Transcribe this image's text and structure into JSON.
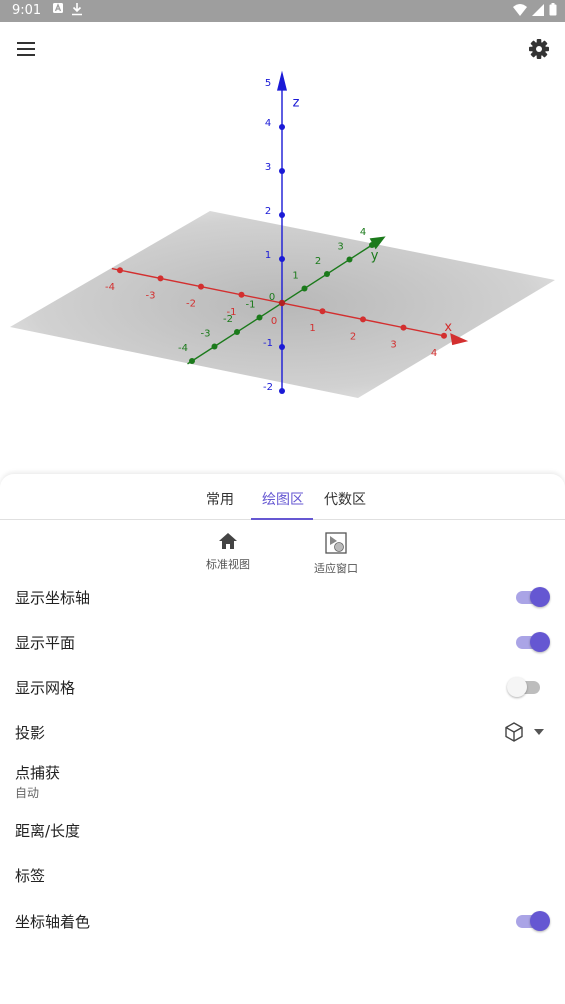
{
  "status_bar": {
    "time": "9:01"
  },
  "graph": {
    "x_axis_label": "x",
    "y_axis_label": "y",
    "z_axis_label": "z",
    "origin_label": "0",
    "x_ticks": [
      "-4",
      "-3",
      "-2",
      "-1",
      "1",
      "2",
      "3",
      "4"
    ],
    "y_ticks": [
      "-4",
      "-3",
      "-2",
      "-1",
      "1",
      "2",
      "3",
      "4"
    ],
    "z_ticks": [
      "-2",
      "-1",
      "1",
      "2",
      "3",
      "4",
      "5"
    ],
    "colors": {
      "x_axis": "#d32f2f",
      "y_axis": "#1b7a1b",
      "z_axis": "#1a1ad6",
      "plane": "#c8c8c8"
    }
  },
  "tabs": [
    {
      "label": "常用"
    },
    {
      "label": "绘图区"
    },
    {
      "label": "代数区"
    }
  ],
  "active_tab": "绘图区",
  "view_buttons": {
    "standard_view": "标准视图",
    "fit_window": "适应窗口"
  },
  "settings": {
    "show_axes": {
      "label": "显示坐标轴",
      "on": true
    },
    "show_plane": {
      "label": "显示平面",
      "on": true
    },
    "show_grid": {
      "label": "显示网格",
      "on": false
    },
    "projection": {
      "label": "投影"
    },
    "point_capturing": {
      "label": "点捕获",
      "value": "自动"
    },
    "distance_length": {
      "label": "距离/长度"
    },
    "labeling": {
      "label": "标签"
    },
    "axis_coloring": {
      "label": "坐标轴着色",
      "on": true
    }
  },
  "accent_color": "#6557d2"
}
